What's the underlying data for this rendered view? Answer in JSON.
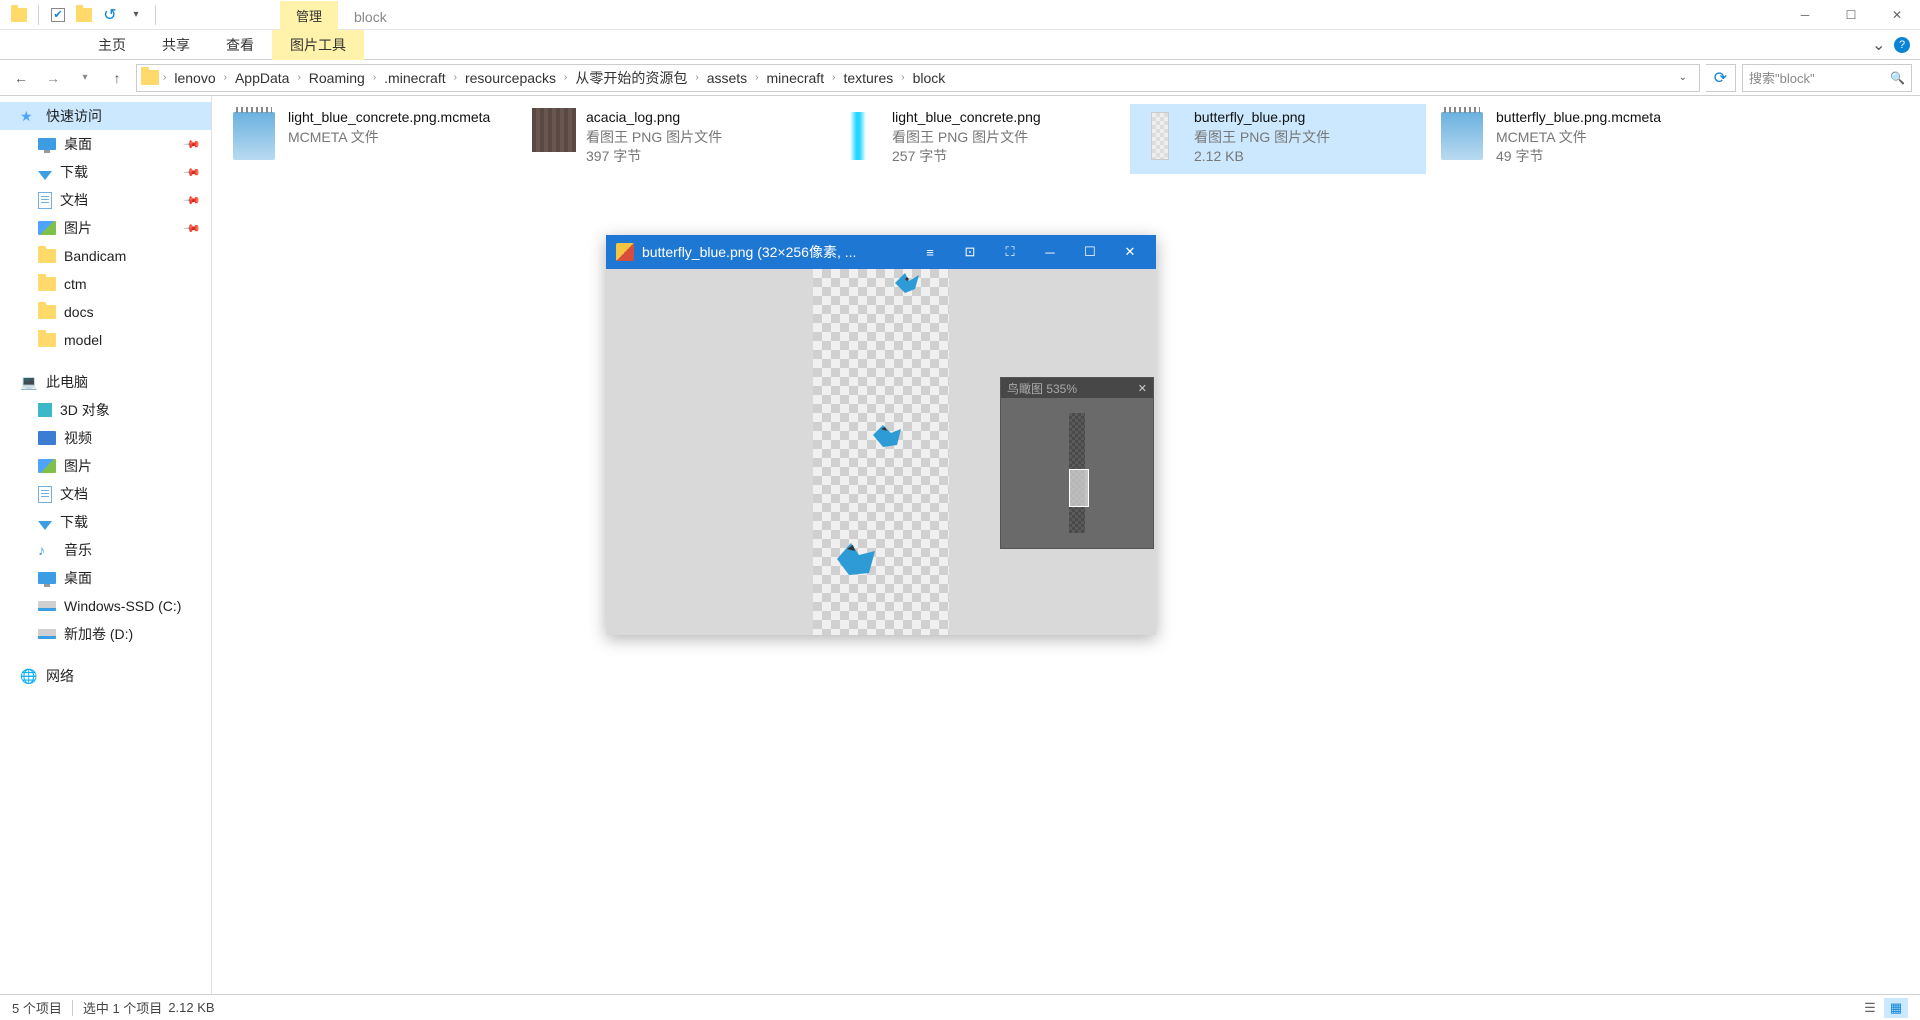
{
  "titlebar": {
    "manage": "管理",
    "title": "block"
  },
  "ribbon": {
    "tabs": [
      "主页",
      "共享",
      "查看",
      "图片工具"
    ]
  },
  "breadcrumb": {
    "items": [
      "lenovo",
      "AppData",
      "Roaming",
      ".minecraft",
      "resourcepacks",
      "从零开始的资源包",
      "assets",
      "minecraft",
      "textures",
      "block"
    ]
  },
  "search": {
    "placeholder": "搜索\"block\""
  },
  "sidebar": {
    "quick": "快速访问",
    "quick_items": [
      "桌面",
      "下载",
      "文档",
      "图片",
      "Bandicam",
      "ctm",
      "docs",
      "model"
    ],
    "pc": "此电脑",
    "pc_items": [
      "3D 对象",
      "视频",
      "图片",
      "文档",
      "下载",
      "音乐",
      "桌面",
      "Windows-SSD (C:)",
      "新加卷 (D:)"
    ],
    "network": "网络"
  },
  "files": [
    {
      "name": "light_blue_concrete.png.mcmeta",
      "type": "MCMETA 文件",
      "size": ""
    },
    {
      "name": "acacia_log.png",
      "type": "看图王 PNG 图片文件",
      "size": "397 字节"
    },
    {
      "name": "light_blue_concrete.png",
      "type": "看图王 PNG 图片文件",
      "size": "257 字节"
    },
    {
      "name": "butterfly_blue.png",
      "type": "看图王 PNG 图片文件",
      "size": "2.12 KB"
    },
    {
      "name": "butterfly_blue.png.mcmeta",
      "type": "MCMETA 文件",
      "size": "49 字节"
    }
  ],
  "statusbar": {
    "count": "5 个项目",
    "selected": "选中 1 个项目",
    "size": "2.12 KB"
  },
  "viewer": {
    "title": "butterfly_blue.png  (32×256像素, ...",
    "birdview": "鸟瞰图 535%"
  }
}
